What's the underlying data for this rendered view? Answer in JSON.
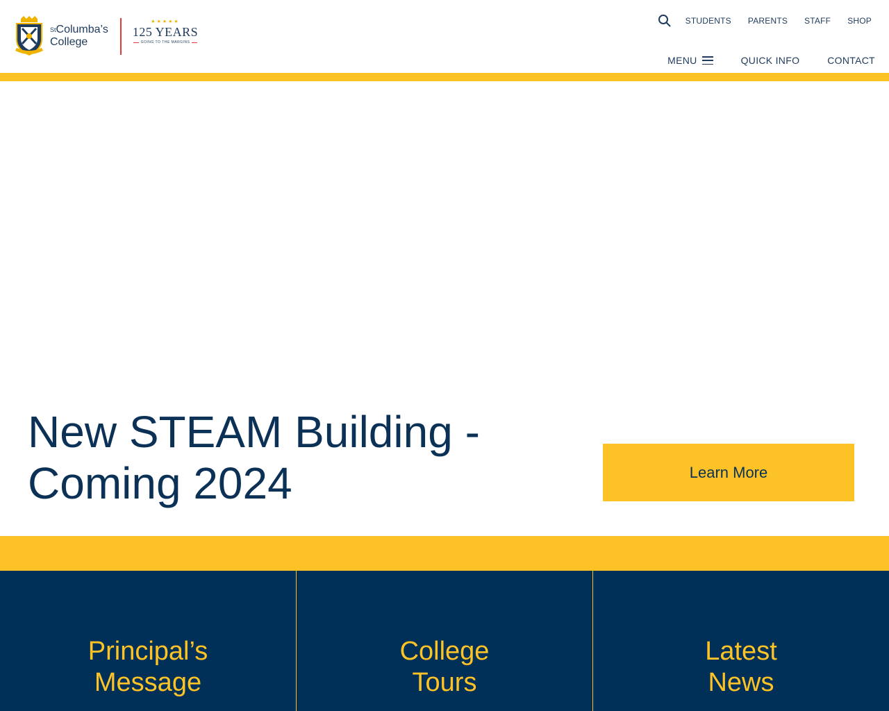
{
  "header": {
    "logo": {
      "name_prefix": "St",
      "name_line1": "Columba’s",
      "name_line2": "College",
      "anniversary": "125 YEARS",
      "anniversary_tagline": "GOING TO THE MARGINS"
    },
    "utility_nav": [
      {
        "label": "STUDENTS"
      },
      {
        "label": "PARENTS"
      },
      {
        "label": "STAFF"
      },
      {
        "label": "SHOP"
      }
    ],
    "main_nav": {
      "menu": "MENU",
      "quick_info": "QUICK INFO",
      "contact": "CONTACT"
    }
  },
  "hero": {
    "title_line1": "New STEAM Building -",
    "title_line2": "Coming 2024",
    "cta_label": "Learn More"
  },
  "tiles": [
    {
      "line1": "Principal’s",
      "line2": "Message"
    },
    {
      "line1": "College",
      "line2": "Tours"
    },
    {
      "line1": "Latest",
      "line2": "News"
    }
  ],
  "colors": {
    "navy": "#003057",
    "text_navy": "#0b3156",
    "yellow": "#fdc326",
    "logo_divider_red": "#e03a3a"
  },
  "icons": [
    "crest-icon",
    "search-icon",
    "hamburger-icon"
  ]
}
